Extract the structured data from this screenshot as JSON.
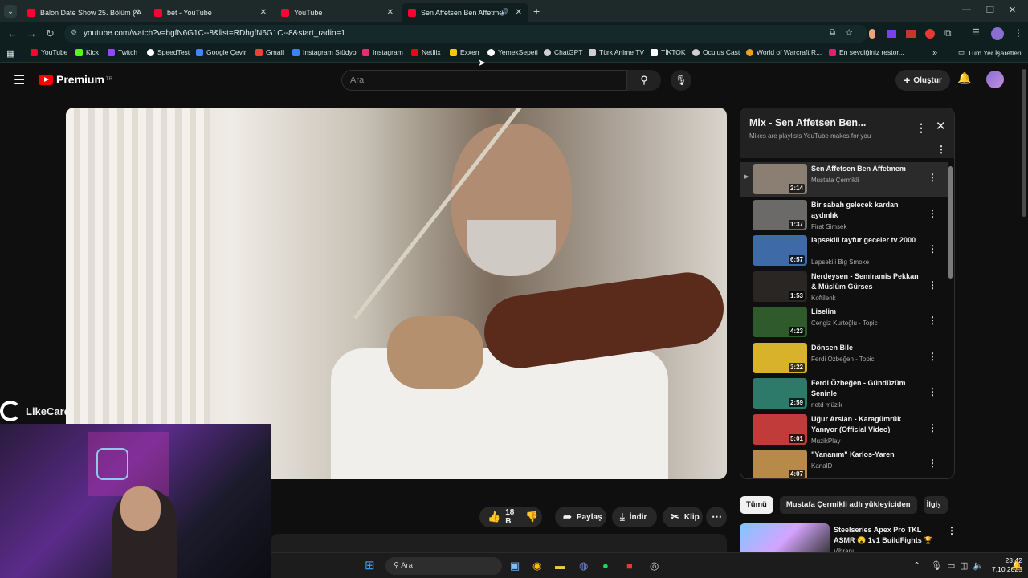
{
  "tabs": [
    {
      "label": "Balon Date Show 25. Bölüm ( A"
    },
    {
      "label": "bet - YouTube"
    },
    {
      "label": "YouTube"
    },
    {
      "label": "Sen Affetsen Ben Affetmem"
    }
  ],
  "address": {
    "url": "youtube.com/watch?v=hgfN6G1C--8&list=RDhgfN6G1C--8&start_radio=1"
  },
  "bookmarks": [
    {
      "label": "YouTube",
      "color": "#ff0033"
    },
    {
      "label": "Kick",
      "color": "#53fc18"
    },
    {
      "label": "Twitch",
      "color": "#9146ff"
    },
    {
      "label": "SpeedTest",
      "color": "#ffffff"
    },
    {
      "label": "Google Çeviri",
      "color": "#4285f4"
    },
    {
      "label": "Gmail",
      "color": "#ea4335"
    },
    {
      "label": "Instagram Stüdyo",
      "color": "#3b82f6"
    },
    {
      "label": "Instagram",
      "color": "#e1306c"
    },
    {
      "label": "Netflix",
      "color": "#e50914"
    },
    {
      "label": "Exxen",
      "color": "#f5c518"
    },
    {
      "label": "YemekSepeti",
      "color": "#ffffff"
    },
    {
      "label": "ChatGPT",
      "color": "#cfcfcf"
    },
    {
      "label": "Türk Anime TV",
      "color": "#cfcfcf"
    },
    {
      "label": "TİKTOK",
      "color": "#ffffff"
    },
    {
      "label": "Oculus Cast",
      "color": "#cfcfcf"
    },
    {
      "label": "World of Warcraft R...",
      "color": "#f0a020"
    },
    {
      "label": "En sevdiğiniz restor...",
      "color": "#e0206e"
    }
  ],
  "bookmarks_more": "»",
  "bookmarks_all": "Tüm Yer İşaretleri",
  "yt": {
    "logo": "Premium",
    "logo_region": "TR",
    "search_placeholder": "Ara",
    "create_label": "Oluştur"
  },
  "overlay": {
    "brand": "LikeCard"
  },
  "actions": {
    "likes": "18 B",
    "share": "Paylaş",
    "download": "İndir",
    "clip": "Klip"
  },
  "playlist": {
    "title": "Mix - Sen Affetsen Ben...",
    "subtitle": "Mixes are playlists YouTube makes for you",
    "items": [
      {
        "title": "Sen Affetsen Ben Affetmem",
        "channel": "Mustafa Çermikli",
        "duration": "2:14",
        "active": true,
        "thumb": "#8a7f72"
      },
      {
        "title": "Bir sabah gelecek kardan aydınlık",
        "channel": "Firat Simsek",
        "duration": "1:37",
        "thumb": "#6b6a68"
      },
      {
        "title": "lapsekili tayfur geceler tv 2000",
        "channel": "Lapsekili Big Smoke",
        "duration": "6:57",
        "thumb": "#3f6aa8"
      },
      {
        "title": "Nerdeysen - Semiramis Pekkan & Müslüm Gürses",
        "channel": "Koftilenk",
        "duration": "1:53",
        "thumb": "#2a2623"
      },
      {
        "title": "Liselim",
        "channel": "Cengiz Kurtoğlu - Topic",
        "duration": "4:23",
        "thumb": "#2f5a2b"
      },
      {
        "title": "Dönsen Bile",
        "channel": "Ferdi Özbeğen - Topic",
        "duration": "3:22",
        "thumb": "#d8b22a"
      },
      {
        "title": "Ferdi Özbeğen - Gündüzüm Seninle",
        "channel": "netd müzik",
        "duration": "2:59",
        "thumb": "#2e7a6a"
      },
      {
        "title": "Uğur Arslan - Karagümrük Yanıyor (Official Video)",
        "channel": "MuzikPlay",
        "duration": "5:01",
        "thumb": "#c23b3b"
      },
      {
        "title": "\"Yananım\" Karlos-Yaren",
        "channel": "KanalD",
        "duration": "4:07",
        "thumb": "#b88a4a"
      }
    ]
  },
  "chips": [
    "Tümü",
    "Mustafa Çermikli adlı yükleyiciden",
    "İlgi"
  ],
  "recommendation": {
    "title": "Steelseries Apex Pro TKL ASMR 😮 1v1 BuildFights 🏆 ...",
    "channel": "Vibranı"
  },
  "taskbar": {
    "search": "Ara",
    "time": "23:42",
    "date": "7.10.2025"
  }
}
